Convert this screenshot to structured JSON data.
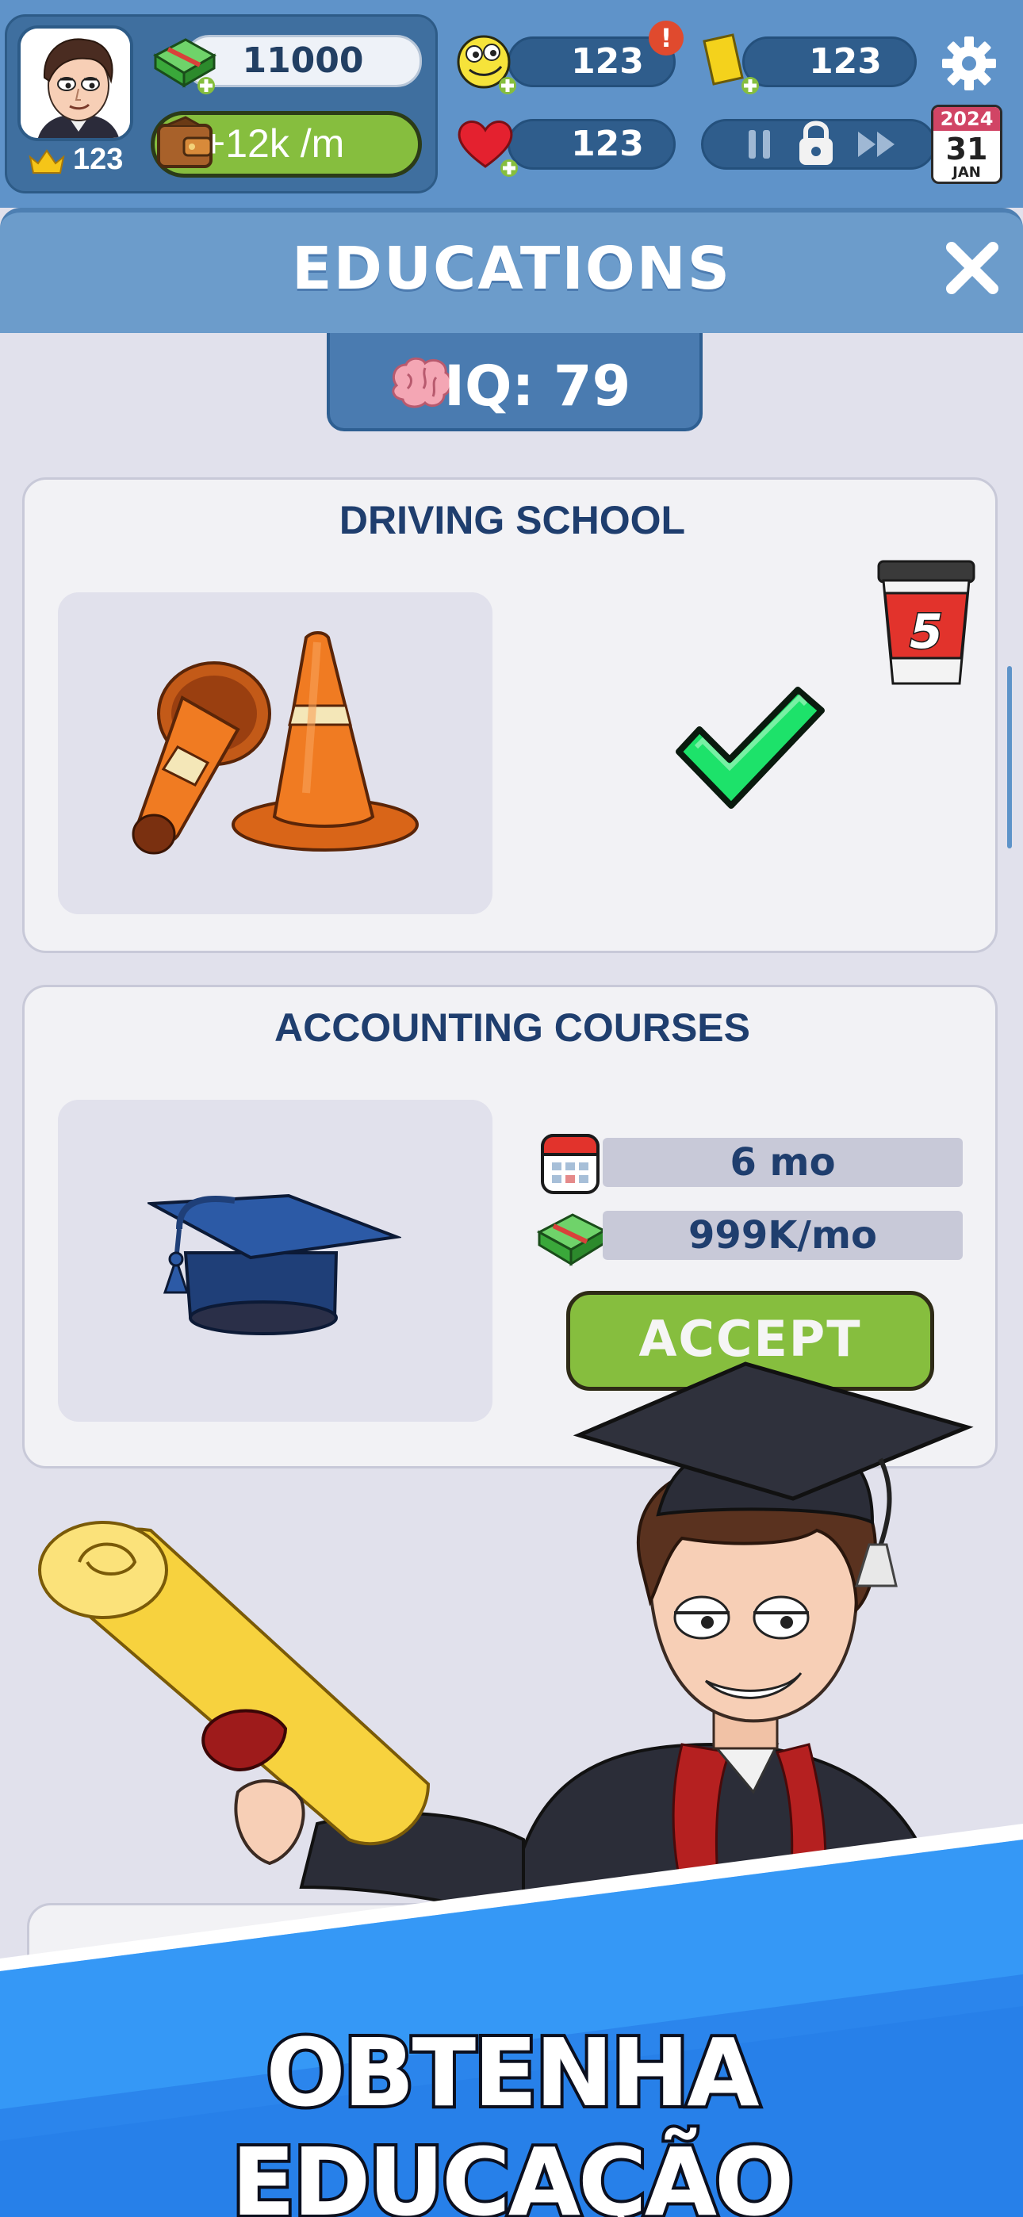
{
  "hud": {
    "level": "123",
    "cash": "11000",
    "income": "+12k /m",
    "iq_points": "123",
    "alert": "!",
    "health": "123",
    "tickets": "123",
    "calendar": {
      "year": "2024",
      "day": "31",
      "month": "JAN"
    },
    "icons": [
      "crown-icon",
      "cash-icon",
      "wallet-icon",
      "brain-face-icon",
      "heart-icon",
      "ticket-icon",
      "gear-icon",
      "pause-icon",
      "lock-icon",
      "fast-forward-icon",
      "calendar-icon"
    ]
  },
  "panel": {
    "title": "EDUCATIONS",
    "iq_label": "IQ: 79"
  },
  "courses": [
    {
      "title": "DRIVING SCHOOL",
      "status": "completed",
      "coffee_count": "5"
    },
    {
      "title": "ACCOUNTING COURSES",
      "duration": "6 mo",
      "cost": "999K/mo",
      "button": "ACCEPT"
    }
  ],
  "banner": {
    "text": "OBTENHA EDUCAÇÃO"
  },
  "colors": {
    "hud_bg": "#5f93c9",
    "panel_header": "#6c9ccb",
    "page_bg": "#e1e1ec",
    "accent_green": "#86be3e",
    "title_navy": "#1f3e6e",
    "banner_blue": "#2f8ff0"
  }
}
